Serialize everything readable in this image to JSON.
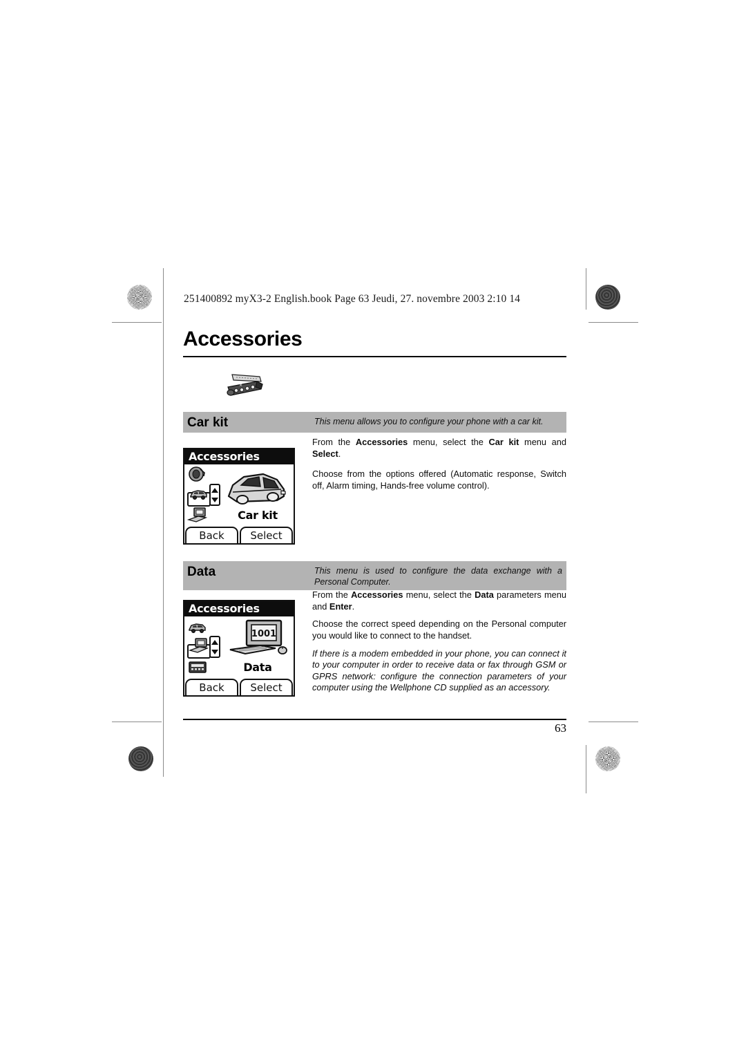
{
  "document": {
    "book_info": "251400892 myX3-2 English.book  Page 63  Jeudi, 27. novembre 2003  2:10 14",
    "chapter_title": "Accessories",
    "page_number": "63"
  },
  "sections": [
    {
      "id": "car-kit",
      "title": "Car kit",
      "description": "This menu allows you to configure your phone with a car kit.",
      "paragraphs": [
        "From the Accessories menu, select the Car kit menu and Select.",
        "Choose from the options offered (Automatic response, Switch off, Alarm timing, Hands-free volume control)."
      ],
      "screen": {
        "title": "Accessories",
        "hero_label": "Car kit",
        "left_key": "Back",
        "right_key": "Select",
        "icons": [
          "headset-icon",
          "car-icon",
          "computer-icon"
        ],
        "selected_icon": "car-icon"
      }
    },
    {
      "id": "data",
      "title": "Data",
      "description": "This menu is used to configure the data exchange with a Personal Computer.",
      "paragraphs": [
        "From the Accessories menu, select the Data parameters menu and Enter.",
        "Choose the correct speed depending on the Personal computer you would like to connect to the handset.",
        "If there is a modem embedded in your phone, you can connect it to your computer in order to receive data or fax through GSM or GPRS network: configure the connection parameters of your computer using the Wellphone CD supplied as an accessory."
      ],
      "screen": {
        "title": "Accessories",
        "hero_label": "Data",
        "left_key": "Back",
        "right_key": "Select",
        "icons": [
          "car-icon",
          "computer-icon",
          "calculator-icon"
        ],
        "selected_icon": "computer-icon",
        "monitor_text": "1001"
      }
    }
  ],
  "colors": {
    "band_gray": "#b3b3b3",
    "ink": "#000000",
    "paper": "#ffffff"
  }
}
